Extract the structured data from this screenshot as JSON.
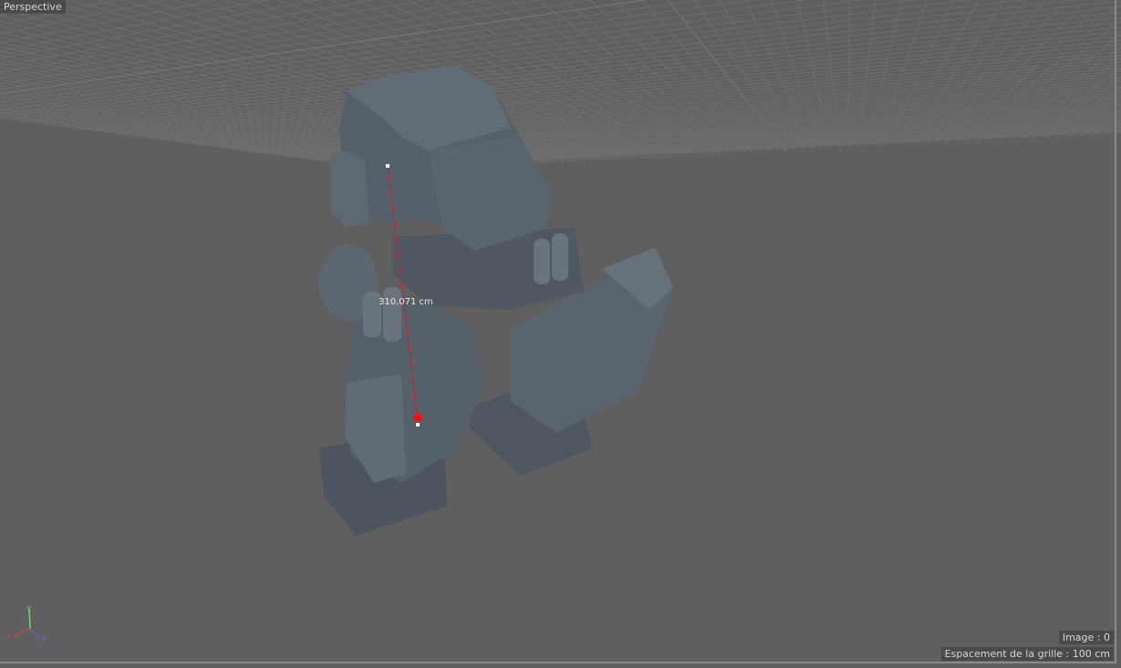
{
  "viewport": {
    "camera_label": "Perspective",
    "measurement": "310.071 cm",
    "frame_info": "Image : 0",
    "grid_spacing": "Espacement de la grille : 100 cm",
    "axes": {
      "x": "X",
      "y": "Y",
      "z": "Z"
    }
  },
  "colors": {
    "background": "#5f5f5f",
    "grid": "#6e6e6e",
    "model": "#56606b",
    "measure": "#d02020"
  }
}
